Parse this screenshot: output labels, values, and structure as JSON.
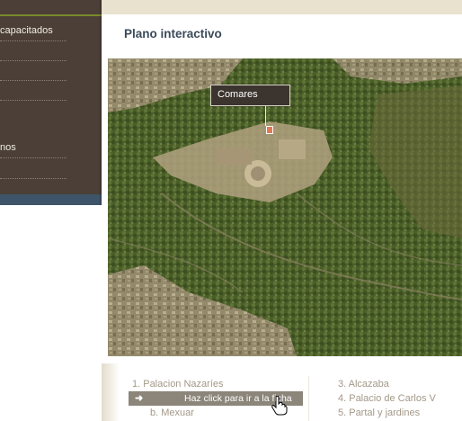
{
  "sidebar": {
    "items": [
      {
        "label": "capacitados"
      },
      {
        "label": ""
      },
      {
        "label": ""
      },
      {
        "label": ""
      },
      {
        "label": "nos"
      },
      {
        "label": ""
      }
    ]
  },
  "main": {
    "title": "Plano interactivo"
  },
  "map": {
    "tooltip_label": "Comares"
  },
  "list": {
    "left": [
      {
        "label": "1. Palacion Nazaríes"
      },
      {
        "label": "b. Mexuar"
      }
    ],
    "hint": {
      "arrow": "➜",
      "text": "Haz click para ir a la ficha"
    },
    "right": [
      {
        "label": "3. Alcazaba"
      },
      {
        "label": "4. Palacio de Carlos V"
      },
      {
        "label": "5. Partal y jardines"
      }
    ]
  },
  "colors": {
    "sidebar_bg": "#4b3f37",
    "title": "#3b4a5a",
    "tooltip_bg": "#3b342f",
    "hint_bar": "#8b857a"
  }
}
